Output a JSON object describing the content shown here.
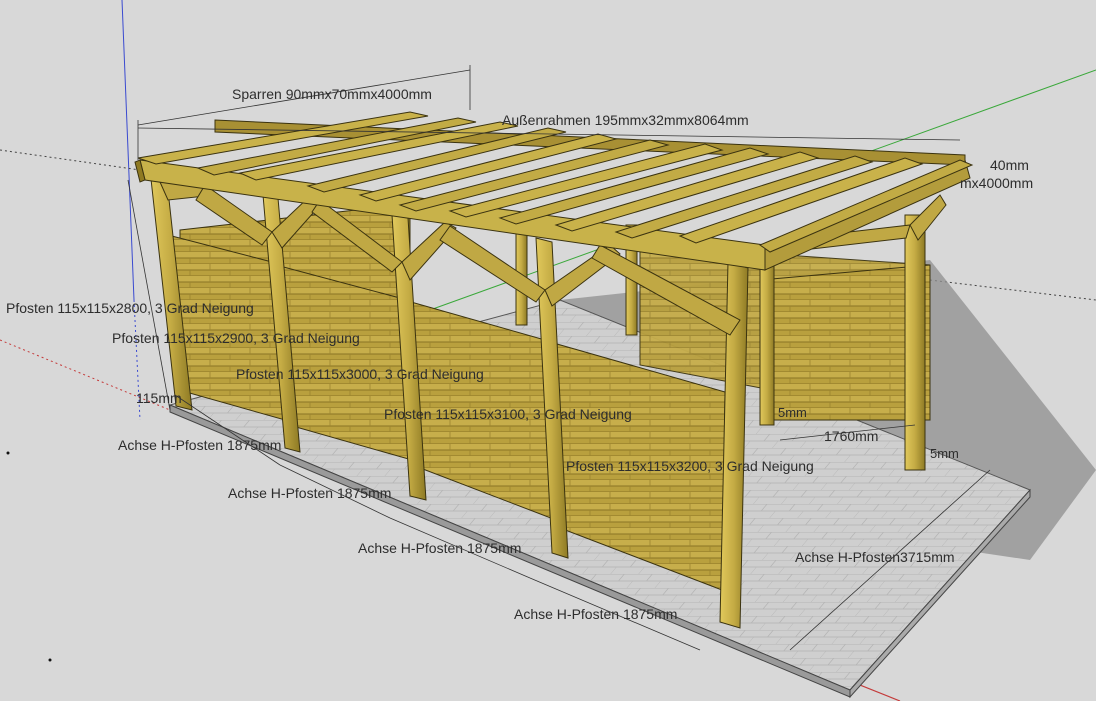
{
  "labels": {
    "rafter": "Sparren 90mmx70mmx4000mm",
    "outer_frame": "Außenrahmen 195mmx32mmx8064mm",
    "right_a": "40mm",
    "right_b": "mx4000mm",
    "post_a": "Pfosten 115x115x2800, 3 Grad Neigung",
    "post_b": "Pfosten 115x115x2900, 3 Grad Neigung",
    "post_c": "Pfosten 115x115x3000, 3 Grad Neigung",
    "post_d": "Pfosten 115x115x3100, 3 Grad Neigung",
    "post_e": "Pfosten 115x115x3200, 3 Grad Neigung",
    "small_115": "115mm",
    "axis_1": "Achse H-Pfosten 1875mm",
    "axis_2": "Achse H-Pfosten 1875mm",
    "axis_3": "Achse H-Pfosten 1875mm",
    "axis_4": "Achse H-Pfosten 1875mm",
    "axis_depth": "Achse H-Pfosten3715mm",
    "depth_1760": "1760mm",
    "mm_a": "5mm",
    "mm_b": "5mm"
  },
  "colors": {
    "background": "#d8d8d8",
    "wood_light": "#c8b24a",
    "wood_dark": "#8f7a22",
    "wood_edge": "#3b3310",
    "panel": "#b89f3c",
    "pavement": "#c9c9c9",
    "shadow": "#8e8e8e",
    "axis_red": "#c43a3a",
    "axis_green": "#3aa83a",
    "axis_blue": "#3a4ad0"
  }
}
